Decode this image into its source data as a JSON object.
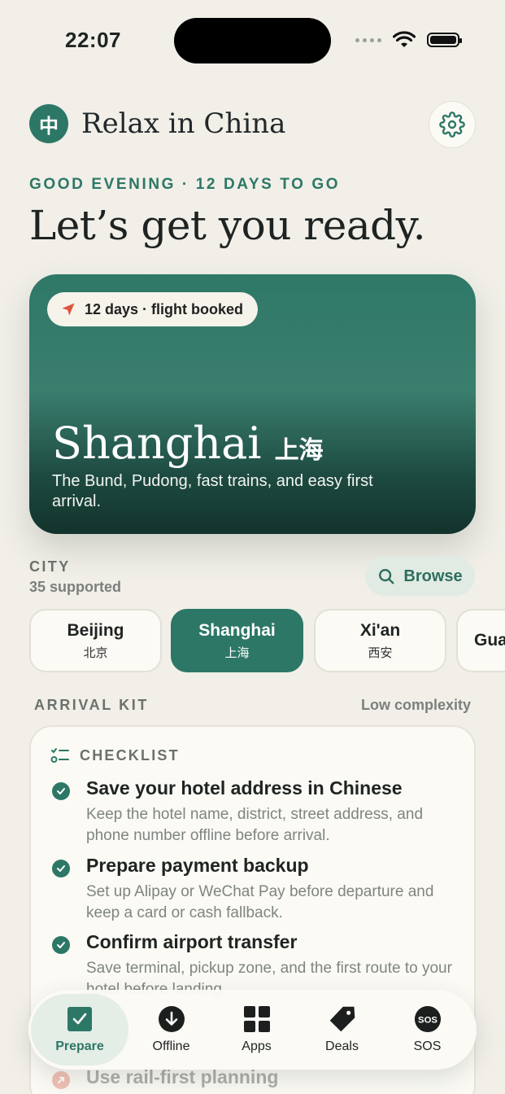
{
  "status_bar": {
    "time": "22:07"
  },
  "header": {
    "logo_text": "中",
    "app_title": "Relax in China",
    "settings_icon": "gear-icon"
  },
  "greeting": "GOOD EVENING · 12 DAYS TO GO",
  "headline": "Let’s get you ready.",
  "hero": {
    "pill_text": "12 days · flight booked",
    "pill_icon": "navigation-arrow-icon",
    "city_en": "Shanghai",
    "city_zh": "上海",
    "description": "The Bund, Pudong, fast trains, and easy first arrival."
  },
  "city_section": {
    "label": "CITY",
    "count": "35 supported",
    "browse_label": "Browse",
    "cities": [
      {
        "en": "Beijing",
        "zh": "北京",
        "selected": false
      },
      {
        "en": "Shanghai",
        "zh": "上海",
        "selected": true
      },
      {
        "en": "Xi'an",
        "zh": "西安",
        "selected": false
      },
      {
        "en": "Gua",
        "zh": "",
        "selected": false
      }
    ]
  },
  "arrival_kit": {
    "label": "ARRIVAL KIT",
    "complexity": "Low complexity",
    "checklist_label": "CHECKLIST",
    "items": [
      {
        "title": "Save your hotel address in Chinese",
        "desc": "Keep the hotel name, district, street address, and phone number offline before arrival."
      },
      {
        "title": "Prepare payment backup",
        "desc": "Set up Alipay or WeChat Pay before departure and keep a card or cash fallback."
      },
      {
        "title": "Confirm airport transfer",
        "desc": "Save terminal, pickup zone, and the first route to your hotel before landing."
      },
      {
        "title": "Use rail-first planning",
        "desc": ""
      }
    ]
  },
  "tabbar": {
    "tabs": [
      {
        "label": "Prepare",
        "icon": "checkbox-icon",
        "active": true
      },
      {
        "label": "Offline",
        "icon": "download-icon",
        "active": false
      },
      {
        "label": "Apps",
        "icon": "grid-icon",
        "active": false
      },
      {
        "label": "Deals",
        "icon": "tag-icon",
        "active": false
      },
      {
        "label": "SOS",
        "icon": "sos-icon",
        "active": false
      }
    ]
  },
  "colors": {
    "accent": "#2d7766",
    "background": "#f1efe8",
    "card": "#fbfaf5"
  }
}
